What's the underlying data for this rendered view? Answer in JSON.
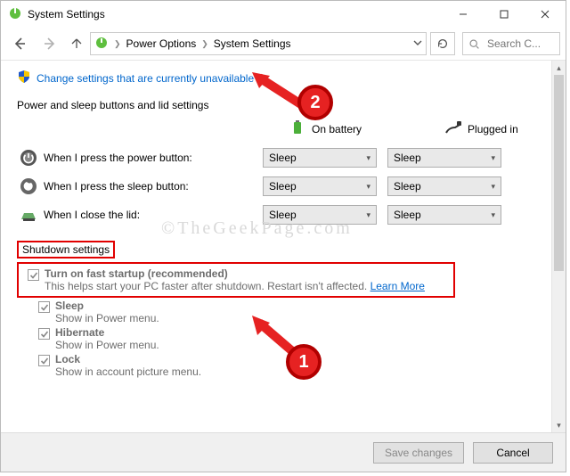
{
  "window": {
    "title": "System Settings"
  },
  "nav": {
    "crumbs": [
      "Power Options",
      "System Settings"
    ],
    "search_placeholder": "Search C..."
  },
  "admin_link": "Change settings that are currently unavailable",
  "section_label": "Power and sleep buttons and lid settings",
  "columns": {
    "battery": "On battery",
    "plugged": "Plugged in"
  },
  "rows": [
    {
      "label": "When I press the power button:",
      "battery": "Sleep",
      "plugged": "Sleep"
    },
    {
      "label": "When I press the sleep button:",
      "battery": "Sleep",
      "plugged": "Sleep"
    },
    {
      "label": "When I close the lid:",
      "battery": "Sleep",
      "plugged": "Sleep"
    }
  ],
  "shutdown": {
    "heading": "Shutdown settings",
    "fast": {
      "title": "Turn on fast startup (recommended)",
      "desc": "This helps start your PC faster after shutdown. Restart isn't affected. ",
      "learn": "Learn More"
    },
    "sleep": {
      "title": "Sleep",
      "desc": "Show in Power menu."
    },
    "hibernate": {
      "title": "Hibernate",
      "desc": "Show in Power menu."
    },
    "lock": {
      "title": "Lock",
      "desc": "Show in account picture menu."
    }
  },
  "footer": {
    "save": "Save changes",
    "cancel": "Cancel"
  },
  "annotations": {
    "one": "1",
    "two": "2"
  },
  "watermark": "©TheGeekPage.com"
}
